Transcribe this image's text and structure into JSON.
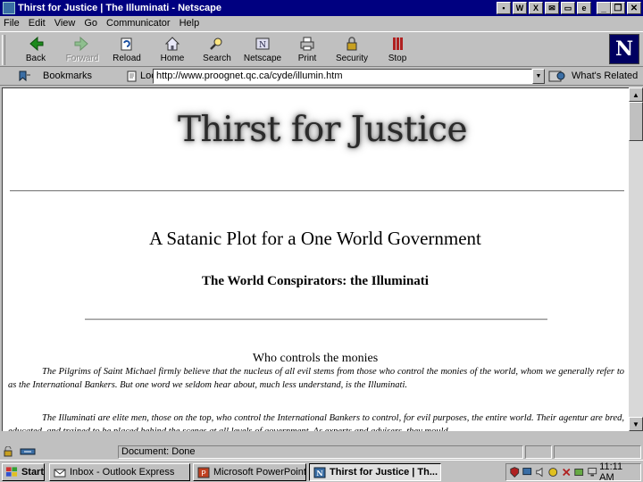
{
  "window": {
    "title": "Thirst for Justice | The Illuminati - Netscape"
  },
  "menu": [
    "File",
    "Edit",
    "View",
    "Go",
    "Communicator",
    "Help"
  ],
  "toolbar": {
    "back": "Back",
    "forward": "Forward",
    "reload": "Reload",
    "home": "Home",
    "search": "Search",
    "netscape": "Netscape",
    "print": "Print",
    "security": "Security",
    "stop": "Stop",
    "logo": "N"
  },
  "location": {
    "bookmarks_label": "Bookmarks",
    "location_label": "Location:",
    "url": "http://www.proognet.qc.ca/cyde/illumin.htm",
    "whats_related": "What's Related"
  },
  "page": {
    "banner": "Thirst for Justice",
    "heading": "A Satanic Plot for a One World Government",
    "subheading": "The World Conspirators: the Illuminati",
    "section_title": "Who controls the monies",
    "paragraph1": "The Pilgrims of Saint Michael firmly believe that the nucleus of all evil stems from those who control the monies of the world, whom we generally refer to as the International Bankers. But one word we seldom hear about, much less understand, is the Illuminati.",
    "paragraph2": "The Illuminati are elite men, those on the top, who control the International Bankers to control, for evil purposes, the entire world. Their agentur are bred, educated, and trained to be placed behind the scenes at all levels of government. As experts and advisers, they mould"
  },
  "status": {
    "text": "Document: Done"
  },
  "taskbar": {
    "start": "Start",
    "tasks": [
      {
        "label": "Inbox - Outlook Express"
      },
      {
        "label": "Microsoft PowerPoint - [C..."
      },
      {
        "label": "Thirst for Justice | Th..."
      }
    ],
    "clock": "11:11 AM"
  },
  "colors": {
    "titlebar": "#000080",
    "chrome": "#c0c0c0",
    "content_bg": "#ffffff"
  }
}
